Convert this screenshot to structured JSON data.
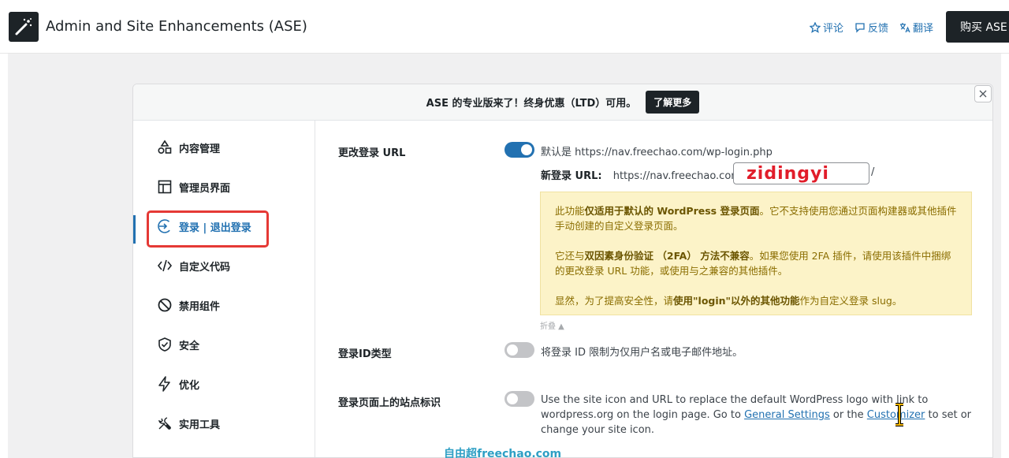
{
  "header": {
    "title": "Admin and Site Enhancements (ASE)",
    "actions": [
      {
        "label": "评论",
        "icon": "star-icon"
      },
      {
        "label": "反馈",
        "icon": "comment-icon"
      },
      {
        "label": "翻译",
        "icon": "translate-icon"
      }
    ],
    "buy_label": "购买 ASE"
  },
  "promo": {
    "text": "ASE 的专业版来了！终身优惠（LTD）可用。",
    "button": "了解更多"
  },
  "sidebar": {
    "items": [
      {
        "label": "内容管理",
        "icon": "shapes-icon"
      },
      {
        "label": "管理员界面",
        "icon": "layout-icon"
      },
      {
        "label": "登录 | 退出登录",
        "icon": "login-icon"
      },
      {
        "label": "自定义代码",
        "icon": "code-icon"
      },
      {
        "label": "禁用组件",
        "icon": "disabled-icon"
      },
      {
        "label": "安全",
        "icon": "shield-icon"
      },
      {
        "label": "优化",
        "icon": "bolt-icon"
      },
      {
        "label": "实用工具",
        "icon": "tools-icon"
      }
    ]
  },
  "settings": {
    "change_login_url": {
      "label": "更改登录 URL",
      "enabled": true,
      "default_text": "默认是 https://nav.freechao.com/wp-login.php",
      "new_login_label": "新登录 URL:",
      "base_url": "https://nav.freechao.com/",
      "slug_value": "zidingyi",
      "slash": "/",
      "notice": {
        "p1_pre": "此功能",
        "p1_bold": "仅适用于默认的 WordPress 登录页面",
        "p1_post": "。它不支持使用您通过页面构建器或其他插件手动创建的自定义登录页面。",
        "p2_pre": "它还与",
        "p2_bold": "双因素身份验证 （2FA） 方法不兼容",
        "p2_post": "。如果您使用 2FA 插件，请使用该插件中捆绑的更改登录 URL 功能，或使用与之兼容的其他插件。",
        "p3_pre": "显然，为了提高安全性，请",
        "p3_bold": "使用\"login\"以外的其他功能",
        "p3_post": "作为自定义登录 slug。"
      },
      "collapse": "折叠 ▲"
    },
    "login_id_type": {
      "label": "登录ID类型",
      "enabled": false,
      "desc": "将登录 ID 限制为仅用户名或电子邮件地址。"
    },
    "site_identity": {
      "label": "登录页面上的站点标识",
      "enabled": false,
      "desc_pre": "Use the site icon and URL to replace the default WordPress logo with link to wordpress.org on the login page. Go to ",
      "link1": "General Settings",
      "desc_mid": " or the ",
      "link2": "Customizer",
      "desc_post": " to set or change your site icon."
    }
  },
  "watermark": "自由超freechao.com",
  "colors": {
    "accent": "#2271b1",
    "highlight": "#e53935",
    "notice_bg": "#fcf3c8"
  }
}
